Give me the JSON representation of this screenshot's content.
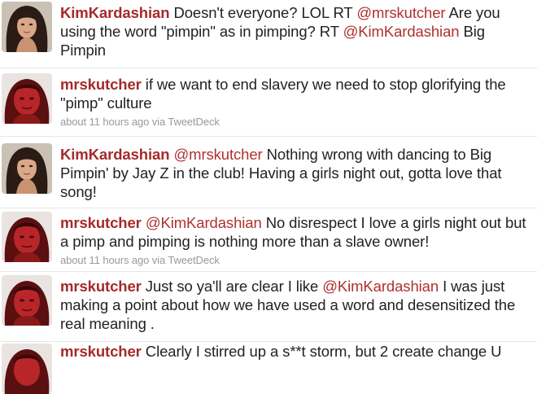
{
  "tweets": [
    {
      "user": "KimKardashian",
      "avatar": "kim-avatar",
      "parts": [
        " Doesn't everyone? LOL RT ",
        "@mrskutcher",
        " Are you using the word \"pimpin\" as in pimping? RT ",
        "@KimKardashian",
        " Big Pimpin"
      ],
      "meta": ""
    },
    {
      "user": "mrskutcher",
      "avatar": "mrskutcher-avatar",
      "parts": [
        " if we want to end slavery we need to stop glorifying the \"pimp\" culture"
      ],
      "meta": "about 11 hours ago via TweetDeck"
    },
    {
      "user": "KimKardashian",
      "avatar": "kim-avatar",
      "parts": [
        " ",
        "@mrskutcher",
        " Nothing wrong with dancing to Big Pimpin' by Jay Z in the club! Having a girls night out, gotta love that song!"
      ],
      "meta": ""
    },
    {
      "user": "mrskutcher",
      "avatar": "mrskutcher-avatar",
      "parts": [
        " ",
        "@KimKardashian",
        " No disrespect I love a girls night out but a pimp and pimping is nothing more than a slave owner!"
      ],
      "meta": "about 11 hours ago via TweetDeck"
    },
    {
      "user": "mrskutcher",
      "avatar": "mrskutcher-avatar",
      "parts": [
        " Just so ya'll are clear I like ",
        "@KimKardashian",
        " I was just making a point about how we have used a word and desensitized the real meaning ."
      ],
      "meta": ""
    },
    {
      "user": "mrskutcher",
      "avatar": "mrskutcher-avatar",
      "parts": [
        " Clearly I stirred up a s**t storm, but 2 create change U"
      ],
      "meta": ""
    }
  ]
}
